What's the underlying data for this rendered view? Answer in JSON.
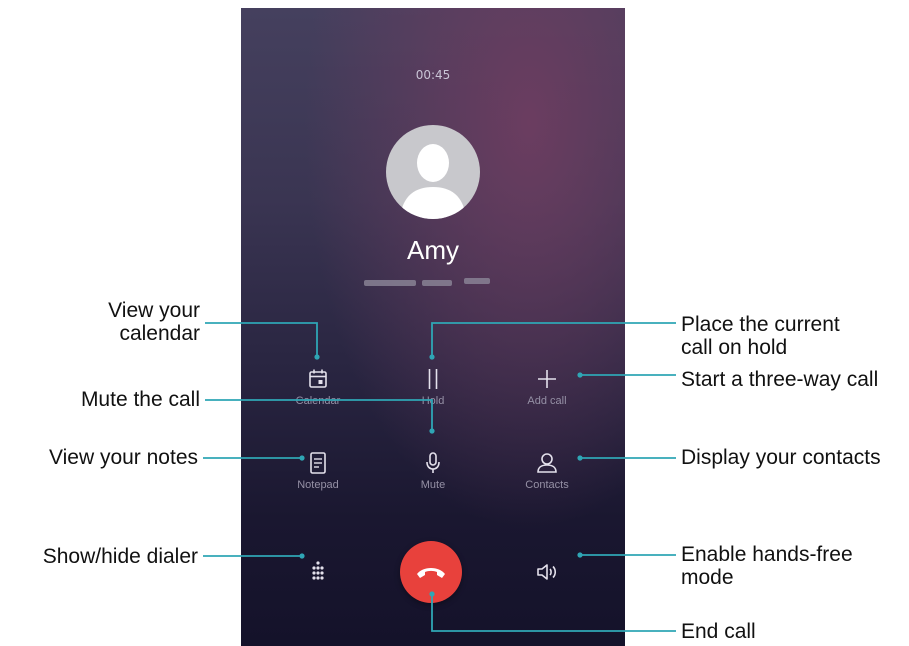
{
  "call": {
    "timer": "00:45",
    "caller_name": "Amy"
  },
  "buttons": {
    "calendar": "Calendar",
    "hold": "Hold",
    "add_call": "Add call",
    "notepad": "Notepad",
    "mute": "Mute",
    "contacts": "Contacts"
  },
  "callouts": {
    "view_calendar": [
      "View your",
      "calendar"
    ],
    "mute_call": "Mute the call",
    "view_notes": "View your notes",
    "show_hide_dialer": "Show/hide dialer",
    "place_hold": [
      "Place the current",
      "call on hold"
    ],
    "three_way": "Start a three-way call",
    "display_contacts": "Display your contacts",
    "hands_free": [
      "Enable hands-free",
      "mode"
    ],
    "end_call": "End call"
  },
  "colors": {
    "callout_line": "#2fa6b5",
    "end_call_red": "#e8413c"
  },
  "icons": [
    "calendar-icon",
    "hold-icon",
    "plus-icon",
    "notepad-icon",
    "microphone-icon",
    "contacts-icon",
    "dialpad-icon",
    "end-call-icon",
    "speaker-icon"
  ]
}
